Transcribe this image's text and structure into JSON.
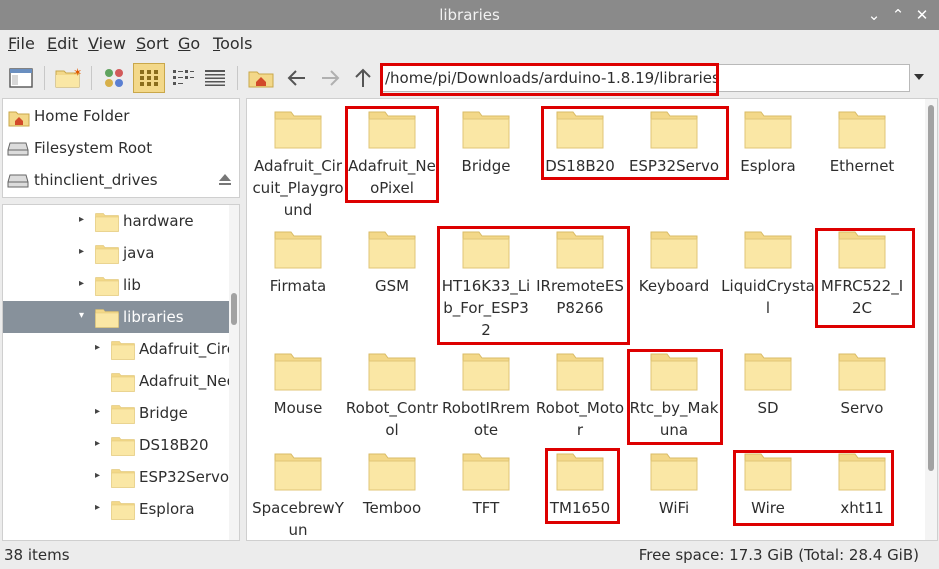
{
  "window": {
    "title": "libraries"
  },
  "menu": [
    "File",
    "Edit",
    "View",
    "Sort",
    "Go",
    "Tools"
  ],
  "menu_mnemonic": [
    "F",
    "E",
    "V",
    "S",
    "G",
    "T"
  ],
  "toolbar": {
    "icons": [
      "new-window-icon",
      "new-folder-icon",
      "icon-view-icon",
      "thumbnail-view-icon",
      "compact-view-icon",
      "detailed-list-view-icon",
      "home-icon",
      "back-arrow-icon",
      "forward-arrow-icon",
      "up-arrow-icon",
      "path-dropdown-icon"
    ],
    "path": "/home/pi/Downloads/arduino-1.8.19/libraries"
  },
  "places": [
    {
      "label": "Home Folder",
      "icon": "home-icon"
    },
    {
      "label": "Filesystem Root",
      "icon": "drive-icon"
    },
    {
      "label": "thinclient_drives",
      "icon": "drive-icon",
      "eject": true
    }
  ],
  "tree": [
    {
      "label": "hardware",
      "level": 1,
      "expander": "collapsed",
      "selected": false
    },
    {
      "label": "java",
      "level": 1,
      "expander": "collapsed",
      "selected": false
    },
    {
      "label": "lib",
      "level": 1,
      "expander": "collapsed",
      "selected": false
    },
    {
      "label": "libraries",
      "level": 1,
      "expander": "expanded",
      "selected": true
    },
    {
      "label": "Adafruit_Circ",
      "level": 2,
      "expander": "collapsed",
      "selected": false
    },
    {
      "label": "Adafruit_Neo",
      "level": 2,
      "expander": "none",
      "selected": false
    },
    {
      "label": "Bridge",
      "level": 2,
      "expander": "collapsed",
      "selected": false
    },
    {
      "label": "DS18B20",
      "level": 2,
      "expander": "collapsed",
      "selected": false
    },
    {
      "label": "ESP32Servo",
      "level": 2,
      "expander": "collapsed",
      "selected": false
    },
    {
      "label": "Esplora",
      "level": 2,
      "expander": "collapsed",
      "selected": false
    }
  ],
  "files": [
    [
      "Adafruit_Cir",
      "cuit_Playgro",
      "und"
    ],
    [
      "Adafruit_Ne",
      "oPixel"
    ],
    [
      "Bridge"
    ],
    [
      "DS18B20"
    ],
    [
      "ESP32Servo"
    ],
    [
      "Esplora"
    ],
    [
      "Ethernet"
    ],
    [
      "Firmata"
    ],
    [
      "GSM"
    ],
    [
      "HT16K33_Li",
      "b_For_ESP3",
      "2"
    ],
    [
      "IRremoteES",
      "P8266"
    ],
    [
      "Keyboard"
    ],
    [
      "LiquidCrysta",
      "l"
    ],
    [
      "MFRC522_I",
      "2C"
    ],
    [
      "Mouse"
    ],
    [
      "Robot_Contr",
      "ol"
    ],
    [
      "RobotIRrem",
      "ote"
    ],
    [
      "Robot_Moto",
      "r"
    ],
    [
      "Rtc_by_Mak",
      "una"
    ],
    [
      "SD"
    ],
    [
      "Servo"
    ],
    [
      "SpacebrewY",
      "un"
    ],
    [
      "Temboo"
    ],
    [
      "TFT"
    ],
    [
      "TM1650"
    ],
    [
      "WiFi"
    ],
    [
      "Wire"
    ],
    [
      "xht11"
    ]
  ],
  "status": {
    "items": "38 items",
    "free_space": "Free space: 17.3 GiB (Total: 28.4 GiB)"
  },
  "colors": {
    "folder_fill": "#fae7a5",
    "folder_tab": "#f3d889",
    "highlight_border": "#dd0000",
    "selection": "#87919b",
    "titlebar": "#8a8a8a"
  }
}
